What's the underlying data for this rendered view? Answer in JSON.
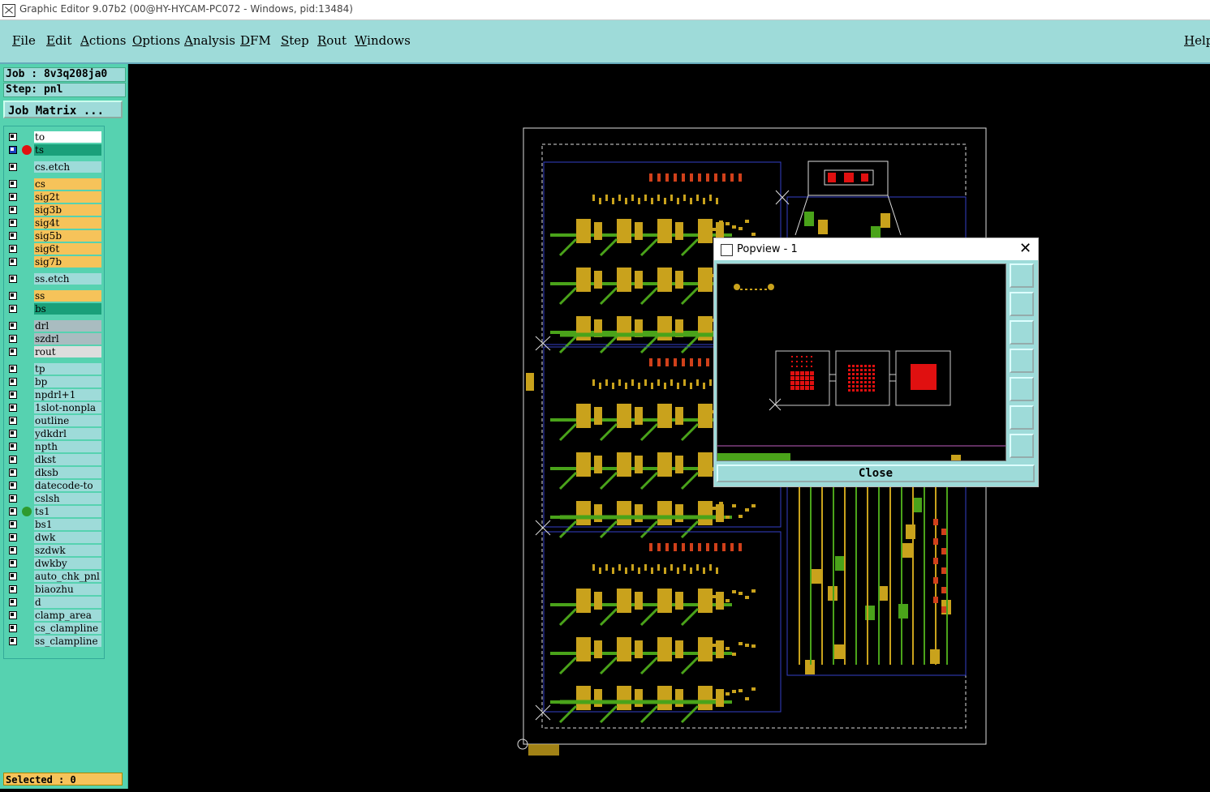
{
  "window": {
    "title": "Graphic Editor 9.07b2 (00@HY-HYCAM-PC072 - Windows, pid:13484)"
  },
  "menu": {
    "items": [
      "File",
      "Edit",
      "Actions",
      "Options",
      "Analysis",
      "DFM",
      "Step",
      "Rout",
      "Windows"
    ],
    "help": "Help"
  },
  "job": {
    "job_label": "Job : 8v3q208ja0",
    "step_label": "Step: pnl",
    "matrix_button": "Job Matrix ..."
  },
  "layers": [
    {
      "name": "to",
      "color": "#ffffff"
    },
    {
      "name": "ts",
      "color": "#1aa07a",
      "active": true
    },
    {
      "name": "cs.etch",
      "color": "#9edbd9"
    },
    {
      "name": "cs",
      "color": "#f6c35a"
    },
    {
      "name": "sig2t",
      "color": "#f6c35a"
    },
    {
      "name": "sig3b",
      "color": "#f6c35a"
    },
    {
      "name": "sig4t",
      "color": "#f6c35a"
    },
    {
      "name": "sig5b",
      "color": "#f6c35a"
    },
    {
      "name": "sig6t",
      "color": "#f6c35a"
    },
    {
      "name": "sig7b",
      "color": "#f6c35a"
    },
    {
      "name": "ss.etch",
      "color": "#9edbd9"
    },
    {
      "name": "ss",
      "color": "#f6c35a"
    },
    {
      "name": "bs",
      "color": "#1aa07a"
    },
    {
      "name": "drl",
      "color": "#a9bcc0"
    },
    {
      "name": "szdrl",
      "color": "#a9bcc0"
    },
    {
      "name": "rout",
      "color": "#dddddd"
    },
    {
      "name": "tp",
      "color": "#9edbd9"
    },
    {
      "name": "bp",
      "color": "#9edbd9"
    },
    {
      "name": "npdrl+1",
      "color": "#9edbd9"
    },
    {
      "name": "1slot-nonpla",
      "color": "#9edbd9"
    },
    {
      "name": "outline",
      "color": "#9edbd9"
    },
    {
      "name": "ydkdrl",
      "color": "#9edbd9"
    },
    {
      "name": "npth",
      "color": "#9edbd9"
    },
    {
      "name": "dkst",
      "color": "#9edbd9"
    },
    {
      "name": "dksb",
      "color": "#9edbd9"
    },
    {
      "name": "datecode-to",
      "color": "#9edbd9"
    },
    {
      "name": "cslsh",
      "color": "#9edbd9"
    },
    {
      "name": "ts1",
      "color": "#9edbd9",
      "dot": "#2e9b2e"
    },
    {
      "name": "bs1",
      "color": "#9edbd9"
    },
    {
      "name": "dwk",
      "color": "#9edbd9"
    },
    {
      "name": "szdwk",
      "color": "#9edbd9"
    },
    {
      "name": "dwkby",
      "color": "#9edbd9"
    },
    {
      "name": "auto_chk_pnl",
      "color": "#9edbd9"
    },
    {
      "name": "biaozhu",
      "color": "#9edbd9"
    },
    {
      "name": "d",
      "color": "#9edbd9"
    },
    {
      "name": "clamp_area",
      "color": "#9edbd9"
    },
    {
      "name": "cs_clampline",
      "color": "#9edbd9"
    },
    {
      "name": "ss_clampline",
      "color": "#9edbd9"
    }
  ],
  "status": {
    "selected": "Selected : 0"
  },
  "popview": {
    "title": "Popview - 1",
    "close_label": "Close",
    "close_x": "✕",
    "tools": [
      "zoom-fit-icon",
      "pan-up-icon",
      "pan-down-icon",
      "pan-left-icon",
      "pan-right-icon",
      "zoom-in-icon",
      "zoom-out-icon"
    ]
  },
  "colors": {
    "board_green": "#4aa31a",
    "board_yellow": "#c9a21c",
    "pad_red": "#e01010",
    "menu_bg": "#9edbd9",
    "panel_bg": "#56d2b0"
  }
}
